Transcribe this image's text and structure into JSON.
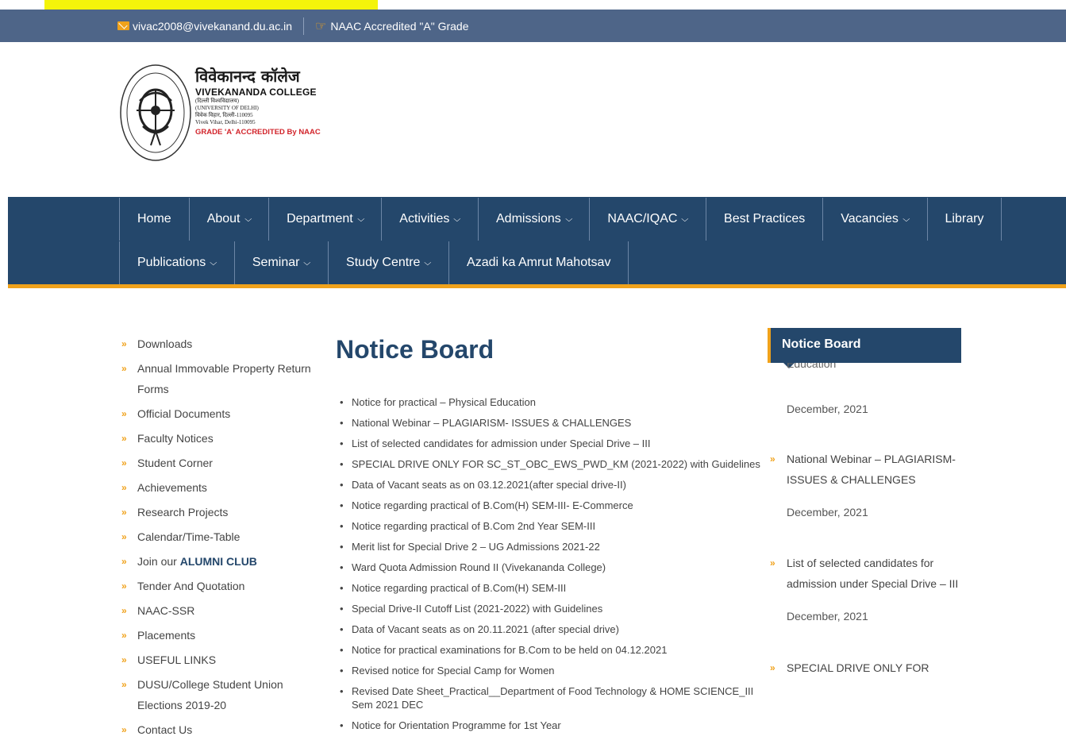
{
  "topbar": {
    "email": "vivac2008@vivekanand.du.ac.in",
    "accreditation": "NAAC Accredited \"A\" Grade"
  },
  "logo": {
    "hindi_name": "विवेकानन्द कॉलेज",
    "english_name": "VIVEKANANDA COLLEGE",
    "line1": "(दिल्ली विश्वविद्यालय)",
    "line2": "(UNIVERSITY OF DELHI)",
    "line3": "विवेक विहार, दिल्ली-110095",
    "line4": "Vivek Vihar, Delhi-110095",
    "grade": "GRADE 'A' ACCREDITED By NAAC"
  },
  "nav": {
    "row1": [
      "Home",
      "About",
      "Department",
      "Activities",
      "Admissions",
      "NAAC/IQAC",
      "Best Practices",
      "Vacancies",
      "Library"
    ],
    "row2": [
      "Publications",
      "Seminar",
      "Study Centre",
      "Azadi ka Amrut Mahotsav"
    ]
  },
  "sidebar": {
    "items": [
      "Downloads",
      "Annual Immovable Property Return Forms",
      "Official Documents",
      "Faculty Notices",
      "Student Corner",
      "Achievements",
      "Research Projects",
      "Calendar/Time-Table",
      "Join our",
      "Tender And Quotation",
      "NAAC-SSR",
      "Placements",
      "USEFUL LINKS",
      "DUSU/College Student Union Elections 2019-20",
      "Contact Us"
    ],
    "alumni_bold": "ALUMNI CLUB"
  },
  "main": {
    "title": "Notice Board",
    "notices": [
      "Notice for practical – Physical Education",
      "National Webinar – PLAGIARISM- ISSUES & CHALLENGES",
      "List of selected candidates for admission under Special Drive – III",
      "SPECIAL DRIVE ONLY FOR SC_ST_OBC_EWS_PWD_KM (2021-2022) with Guidelines",
      "Data of Vacant seats as on 03.12.2021(after special drive-II)",
      "Notice regarding practical of B.Com(H) SEM-III- E-Commerce",
      "Notice regarding practical of B.Com 2nd Year SEM-III",
      "Merit list for Special Drive 2 – UG Admissions 2021-22",
      "Ward Quota Admission Round II (Vivekananda College)",
      "Notice regarding practical of B.Com(H) SEM-III",
      "Special Drive-II Cutoff List (2021-2022) with Guidelines",
      "Data of Vacant seats as on 20.11.2021 (after special drive)",
      "Notice for practical examinations for B.Com to be held on 04.12.2021",
      "Revised notice for Special Camp for Women",
      "Revised Date Sheet_Practical__Department of Food Technology & HOME SCIENCE_III Sem 2021 DEC",
      "Notice for Orientation Programme for 1st Year"
    ]
  },
  "widget": {
    "title": "Notice Board",
    "partial_title": "Education",
    "entries": [
      {
        "date": "December, 2021"
      },
      {
        "title": "National Webinar – PLAGIARISM- ISSUES & CHALLENGES",
        "date": "December, 2021"
      },
      {
        "title": "List of selected candidates for admission under Special Drive – III",
        "date": "December, 2021"
      },
      {
        "title": "SPECIAL DRIVE ONLY FOR"
      }
    ]
  },
  "colors": {
    "topbar": "#4e6588",
    "nav": "#24476b",
    "accent": "#f0a21b",
    "highlight": "#f4f40a"
  },
  "icons": [
    "mail-icon",
    "hand-pointer-icon",
    "chevron-down-icon",
    "double-arrow-icon"
  ]
}
